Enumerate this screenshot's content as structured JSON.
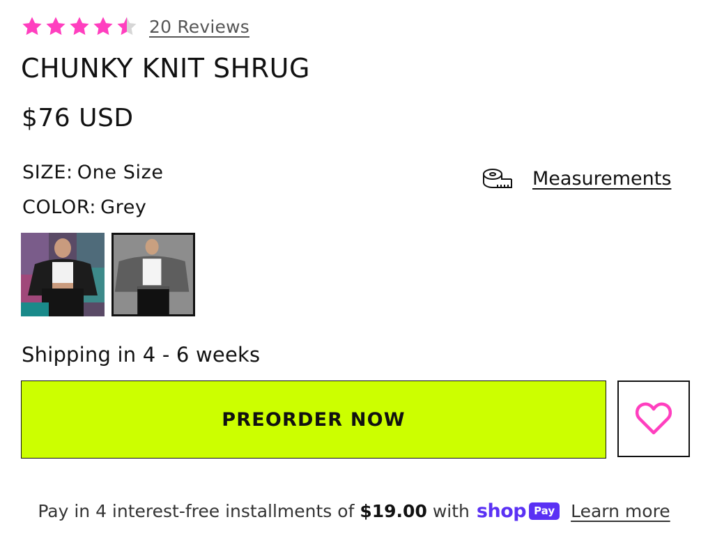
{
  "rating": {
    "stars_filled": 4.5,
    "stars_total": 5,
    "reviews_label": "20 Reviews",
    "star_color": "#ff3fbf",
    "star_empty_color": "#cccccc"
  },
  "product": {
    "title": "CHUNKY KNIT SHRUG",
    "price": "$76 USD"
  },
  "options": {
    "size": {
      "label": "SIZE:",
      "value": "One Size"
    },
    "color": {
      "label": "COLOR:",
      "value": "Grey"
    },
    "measurements_label": "Measurements",
    "measurements_icon": "tape-measure-icon"
  },
  "swatches": [
    {
      "name": "black-shrug-swatch",
      "selected": false
    },
    {
      "name": "grey-shrug-swatch",
      "selected": true
    }
  ],
  "shipping": {
    "text": "Shipping in 4 - 6 weeks"
  },
  "actions": {
    "preorder_label": "PREORDER NOW",
    "preorder_color": "#ccff00",
    "wishlist_icon": "heart-icon",
    "wishlist_color": "#ff3fbf"
  },
  "installments": {
    "prefix": "Pay in 4 interest-free installments of",
    "amount": "$19.00",
    "suffix": "with",
    "shop_word": "shop",
    "pay_badge": "Pay",
    "shop_color": "#5a31f4",
    "learn_more": "Learn more"
  }
}
